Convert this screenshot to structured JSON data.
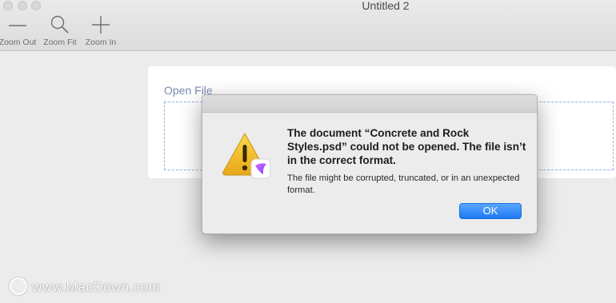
{
  "window": {
    "title": "Untitled 2"
  },
  "toolbar": {
    "zoom_out": {
      "label": "Zoom Out",
      "icon": "minus-icon"
    },
    "zoom_fit": {
      "label": "Zoom Fit",
      "icon": "magnifier-icon"
    },
    "zoom_in": {
      "label": "Zoom In",
      "icon": "plus-icon"
    }
  },
  "main": {
    "open_file_label": "Open File"
  },
  "dialog": {
    "title": "The document “Concrete and Rock Styles.psd” could not be opened. The file isn’t in the correct format.",
    "body": "The file might be corrupted, truncated, or in an unexpected format.",
    "ok_label": "OK",
    "icon": "warning-icon"
  },
  "watermark": {
    "text": "www.MacDown.com"
  },
  "colors": {
    "accent": "#1d79f2",
    "warning": "#f2c12e",
    "link": "#7b8ab5"
  }
}
